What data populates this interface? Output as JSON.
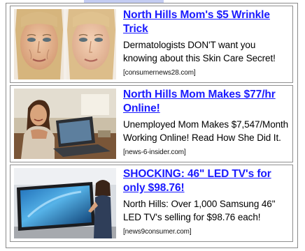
{
  "colors": {
    "headline_link": "#1a1aff",
    "border": "#8f8f8f",
    "top_strip": "#c3ccf2"
  },
  "ads": [
    {
      "headline": "North Hills Mom's $5 Wrinkle Trick",
      "description": "Dermatologists DON'T want you knowing about this Skin Care Secret!",
      "source": "[consumernews28.com]",
      "image": "before-after-face-photo"
    },
    {
      "headline": "North Hills Mom Makes $77/hr Online!",
      "description": "Unemployed Mom Makes $7,547/Month Working Online! Read How She Did It.",
      "source": "[news-6-insider.com]",
      "image": "woman-at-laptop-photo"
    },
    {
      "headline": "SHOCKING: 46\" LED TV's for only $98.76!",
      "description": "North Hills: Over 1,000 Samsung 46\" LED TV's selling for $98.76 each!",
      "source": "[news9consumer.com]",
      "image": "woman-with-large-tv-photo"
    }
  ]
}
